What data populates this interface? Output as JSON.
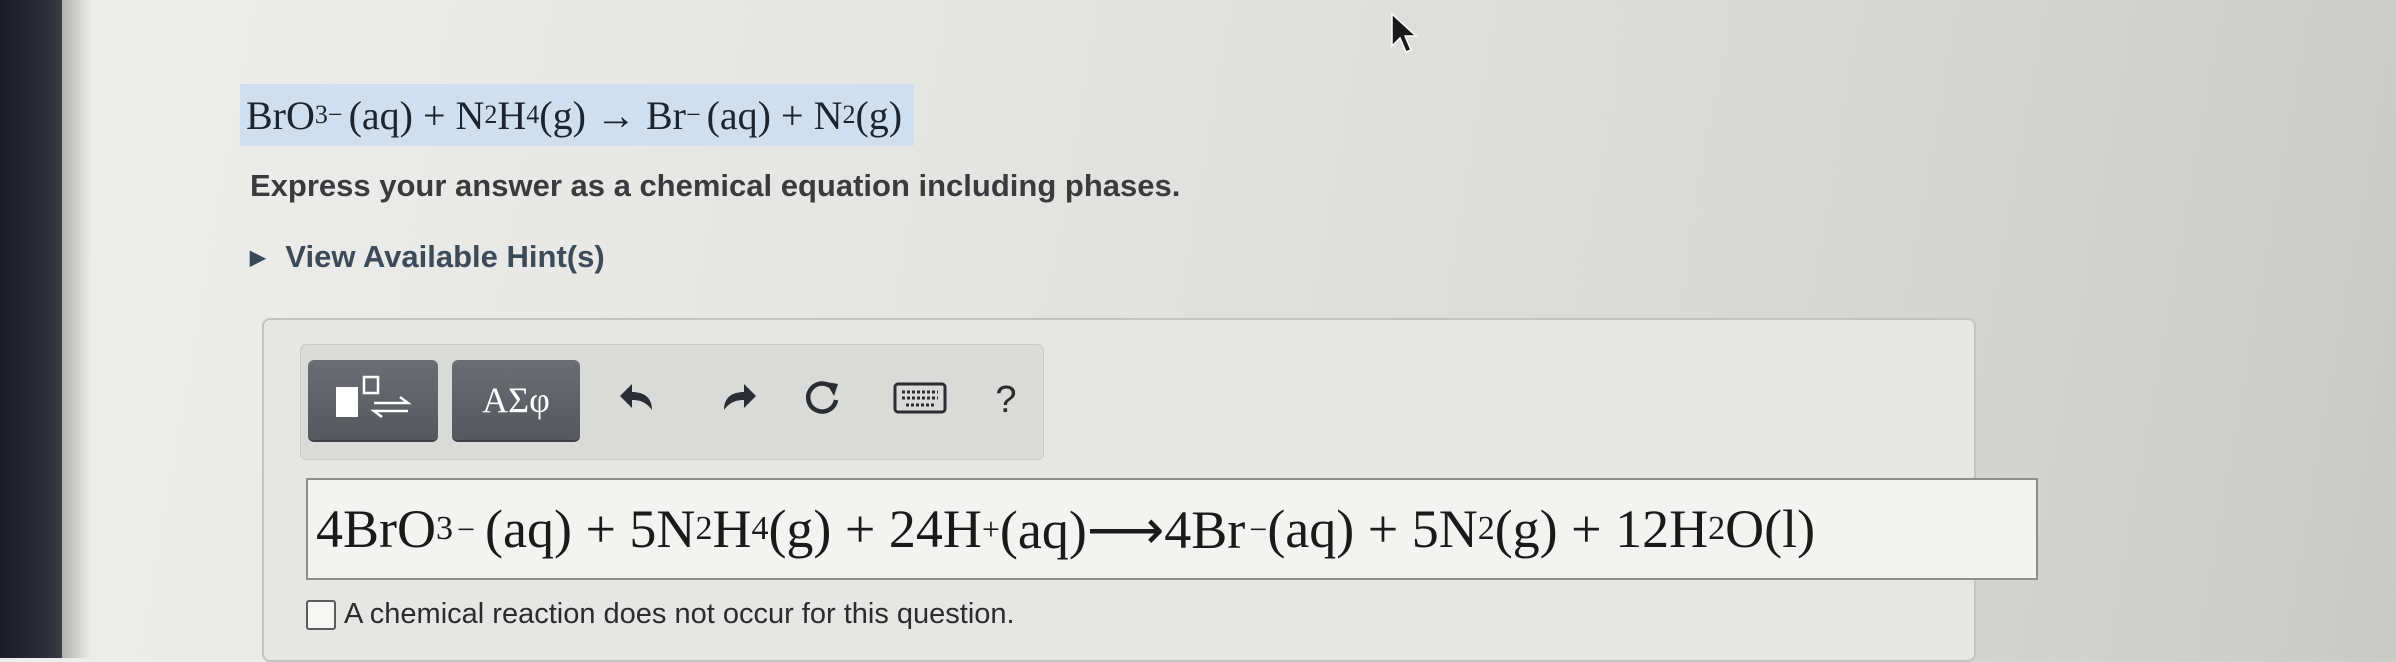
{
  "reaction": {
    "br": "BrO",
    "br_sub": "3",
    "br_sup": "−",
    "aq1": "(aq) + N",
    "n_sub": "2",
    "h": "H",
    "h_sub": "4",
    "g_arrow": "(g) → Br",
    "br_minus": "−",
    "aq2": "(aq) + N",
    "n2_sub": "2",
    "g_end": "(g)"
  },
  "instruction": "Express your answer as a chemical equation including phases.",
  "hints_label": "View Available Hint(s)",
  "toolbar": {
    "greek_label": "ΑΣφ",
    "help_label": "?",
    "icons": [
      "templates-icon",
      "greek-symbols-icon",
      "undo-icon",
      "redo-icon",
      "reset-icon",
      "keyboard-icon",
      "help-icon"
    ]
  },
  "answer": {
    "t1": "4BrO",
    "t1_sub": "3",
    "t1_sup": "−",
    "t2": " (aq) + 5N",
    "t2_sub": "2",
    "t3": " H",
    "t3_sub": "4",
    "t4": " (g) + 24H",
    "t4_sup": "+",
    "t5": " (aq)⟶4Br",
    "t5_sup": "−",
    "t6": " (aq) + 5N",
    "t6_sub": "2",
    "t7": " (g) + 12H",
    "t7_sub": "2",
    "t8": " O(l)"
  },
  "no_reaction_label": "A chemical reaction does not occur for this question.",
  "colors": {
    "highlight": "#cfdff0",
    "button": "#5f6368",
    "hint_text": "#3d4a58"
  }
}
